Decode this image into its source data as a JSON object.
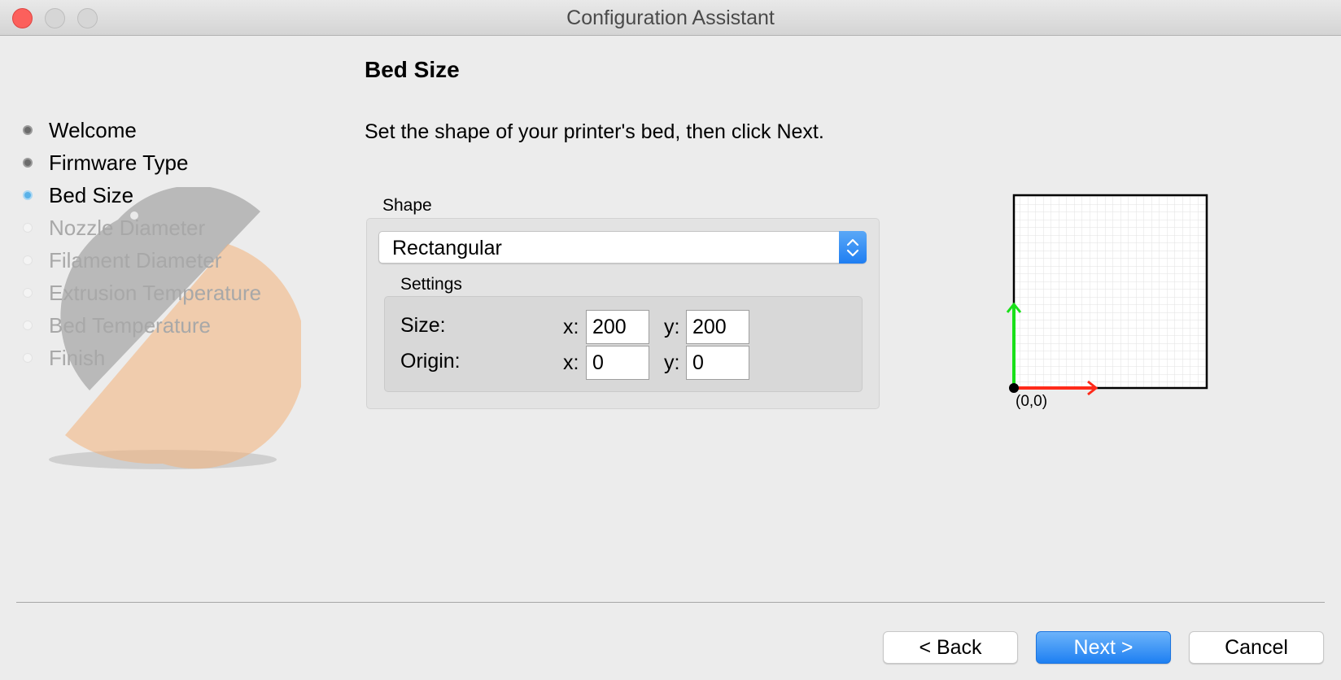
{
  "window": {
    "title": "Configuration Assistant"
  },
  "steps": [
    {
      "label": "Welcome",
      "state": "done"
    },
    {
      "label": "Firmware Type",
      "state": "done"
    },
    {
      "label": "Bed Size",
      "state": "current"
    },
    {
      "label": "Nozzle Diameter",
      "state": "todo"
    },
    {
      "label": "Filament Diameter",
      "state": "todo"
    },
    {
      "label": "Extrusion Temperature",
      "state": "todo"
    },
    {
      "label": "Bed Temperature",
      "state": "todo"
    },
    {
      "label": "Finish",
      "state": "todo"
    }
  ],
  "page": {
    "title": "Bed Size",
    "instruction": "Set the shape of your printer's bed, then click Next."
  },
  "shape": {
    "label": "Shape",
    "selected": "Rectangular",
    "settings_label": "Settings",
    "size": {
      "label": "Size:",
      "x_label": "x:",
      "x": "200",
      "y_label": "y:",
      "y": "200"
    },
    "origin": {
      "label": "Origin:",
      "x_label": "x:",
      "x": "0",
      "y_label": "y:",
      "y": "0"
    }
  },
  "preview": {
    "origin_label": "(0,0)",
    "x_axis_color": "#ff2a1a",
    "y_axis_color": "#19e019"
  },
  "buttons": {
    "back": "< Back",
    "next": "Next >",
    "cancel": "Cancel"
  },
  "colors": {
    "accent": "#1e80f2",
    "current_step": "#5ab2e8"
  }
}
